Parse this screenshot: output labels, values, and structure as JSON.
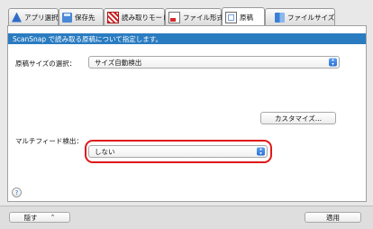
{
  "tabs": [
    {
      "label": "アプリ選択",
      "icon": "app-select-icon"
    },
    {
      "label": "保存先",
      "icon": "save-folder-icon"
    },
    {
      "label": "読み取りモード",
      "icon": "scan-mode-icon"
    },
    {
      "label": "ファイル形式",
      "icon": "file-format-icon"
    },
    {
      "label": "原稿",
      "icon": "document-icon"
    },
    {
      "label": "ファイルサイズ",
      "icon": "file-size-icon"
    }
  ],
  "active_tab": "原稿",
  "info_bar": "ScanSnap で読み取る原稿について指定します。",
  "paper_size": {
    "label": "原稿サイズの選択：",
    "value": "サイズ自動検出"
  },
  "customize_button": "カスタマイズ...",
  "multifeed": {
    "label": "マルチフィード検出：",
    "value": "しない"
  },
  "help_glyph": "?",
  "footer": {
    "hide_button": "隠す",
    "hide_chevron": "⌃",
    "apply_button": "適用"
  },
  "colors": {
    "info_bar_bg": "#2a7cc1",
    "highlight": "#e01818"
  }
}
